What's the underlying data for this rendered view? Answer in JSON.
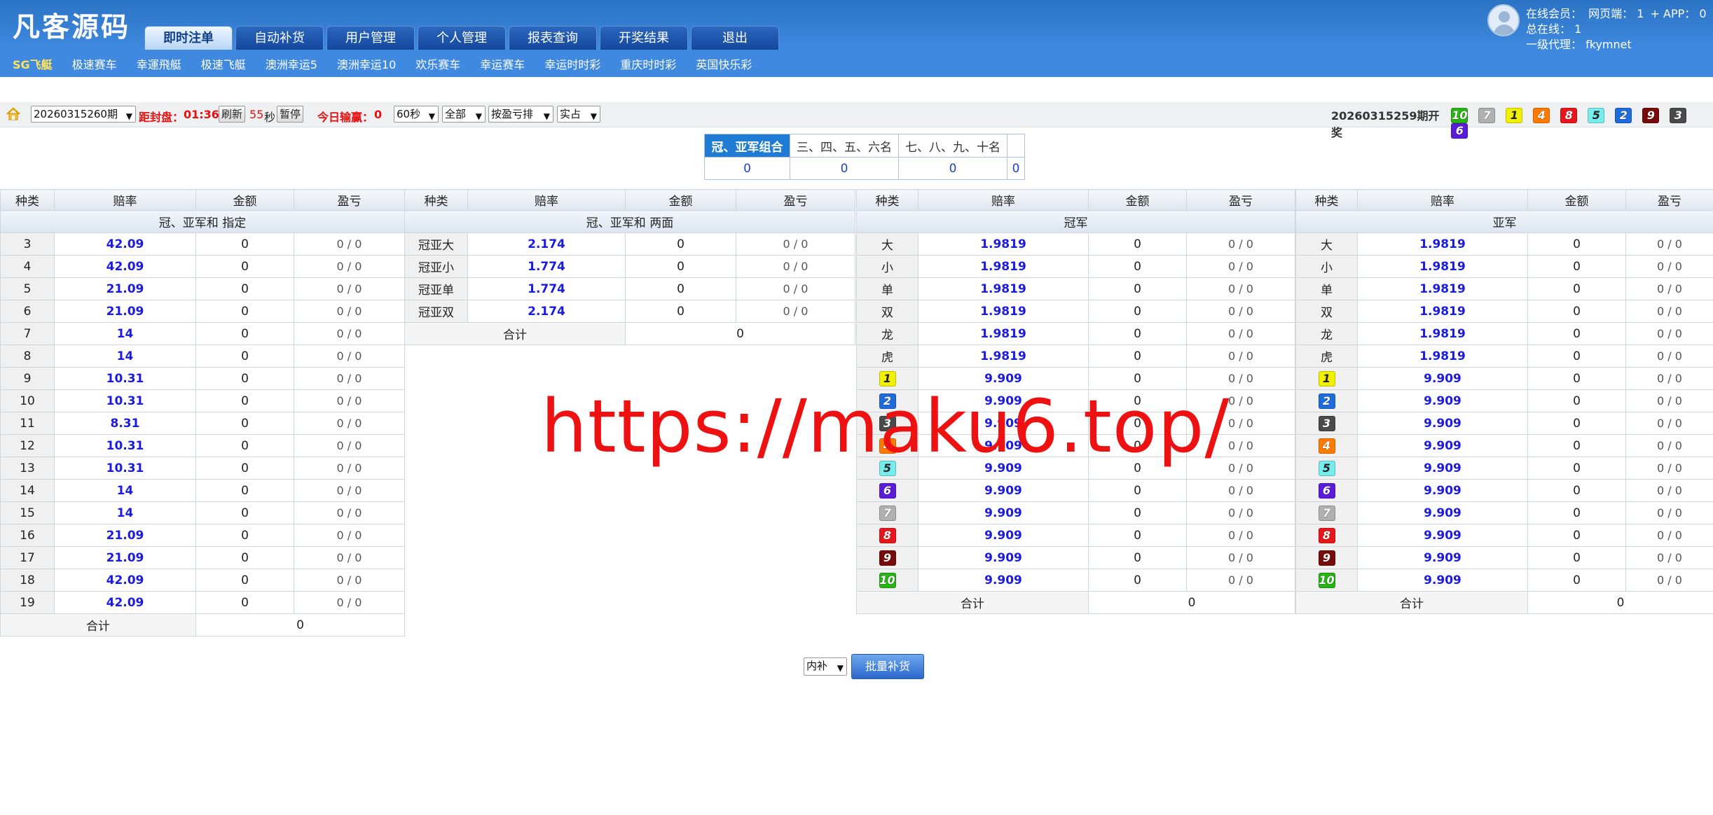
{
  "app": {
    "logo": "凡客源码"
  },
  "nav": [
    "即时注单",
    "自动补货",
    "用户管理",
    "个人管理",
    "报表查询",
    "开奖结果",
    "退出"
  ],
  "user": {
    "online_label": "在线会员：",
    "web_label": "网页端：",
    "web_value": "1",
    "app_label": "+ APP：",
    "app_value": "0",
    "total_label": "总在线：",
    "total_value": "1",
    "agent_label": "一级代理：",
    "agent_value": "fkymnet"
  },
  "subnav": [
    "SG飞艇",
    "极速赛车",
    "幸運飛艇",
    "极速飞艇",
    "澳洲幸运5",
    "澳洲幸运10",
    "欢乐赛车",
    "幸运赛车",
    "幸运时时彩",
    "重庆时时彩",
    "英国快乐彩"
  ],
  "toolbar": {
    "period_select": "20260315260期",
    "close_label": "距封盘：",
    "close_time": "01:36",
    "refresh_btn": "刷新",
    "countdown": "55",
    "seconds_unit": "秒",
    "pause_btn": "暂停",
    "today_label": "今日输赢：",
    "today_value": "0",
    "interval_select": "60秒",
    "scope_select": "全部",
    "sort_select": "按盈亏排",
    "mode_select": "实占",
    "last_period": "20260315259期开奖",
    "last_balls": [
      10,
      7,
      1,
      4,
      8,
      5,
      2,
      9,
      3,
      6
    ]
  },
  "position_tabs": {
    "labels": [
      "冠、亚军组合",
      "三、四、五、六名",
      "七、八、九、十名",
      ""
    ],
    "sums": [
      "0",
      "0",
      "0",
      "0"
    ],
    "active": 0
  },
  "headers": {
    "type": "种类",
    "odds": "赔率",
    "amount": "金额",
    "pl": "盈亏",
    "total": "合计"
  },
  "panels": {
    "sum_specific": {
      "title": "冠、亚军和 指定",
      "rows": [
        {
          "k": "3",
          "o": "42.09",
          "a": "0",
          "p": "0 / 0"
        },
        {
          "k": "4",
          "o": "42.09",
          "a": "0",
          "p": "0 / 0"
        },
        {
          "k": "5",
          "o": "21.09",
          "a": "0",
          "p": "0 / 0"
        },
        {
          "k": "6",
          "o": "21.09",
          "a": "0",
          "p": "0 / 0"
        },
        {
          "k": "7",
          "o": "14",
          "a": "0",
          "p": "0 / 0"
        },
        {
          "k": "8",
          "o": "14",
          "a": "0",
          "p": "0 / 0"
        },
        {
          "k": "9",
          "o": "10.31",
          "a": "0",
          "p": "0 / 0"
        },
        {
          "k": "10",
          "o": "10.31",
          "a": "0",
          "p": "0 / 0"
        },
        {
          "k": "11",
          "o": "8.31",
          "a": "0",
          "p": "0 / 0"
        },
        {
          "k": "12",
          "o": "10.31",
          "a": "0",
          "p": "0 / 0"
        },
        {
          "k": "13",
          "o": "10.31",
          "a": "0",
          "p": "0 / 0"
        },
        {
          "k": "14",
          "o": "14",
          "a": "0",
          "p": "0 / 0"
        },
        {
          "k": "15",
          "o": "14",
          "a": "0",
          "p": "0 / 0"
        },
        {
          "k": "16",
          "o": "21.09",
          "a": "0",
          "p": "0 / 0"
        },
        {
          "k": "17",
          "o": "21.09",
          "a": "0",
          "p": "0 / 0"
        },
        {
          "k": "18",
          "o": "42.09",
          "a": "0",
          "p": "0 / 0"
        },
        {
          "k": "19",
          "o": "42.09",
          "a": "0",
          "p": "0 / 0"
        }
      ],
      "total": "0"
    },
    "sum_both": {
      "title": "冠、亚军和 两面",
      "rows": [
        {
          "k": "冠亚大",
          "o": "2.174",
          "a": "0",
          "p": "0 / 0"
        },
        {
          "k": "冠亚小",
          "o": "1.774",
          "a": "0",
          "p": "0 / 0"
        },
        {
          "k": "冠亚单",
          "o": "1.774",
          "a": "0",
          "p": "0 / 0"
        },
        {
          "k": "冠亚双",
          "o": "2.174",
          "a": "0",
          "p": "0 / 0"
        }
      ],
      "total": "0"
    },
    "champion": {
      "title": "冠军",
      "rows": [
        {
          "k": "大",
          "o": "1.9819",
          "a": "0",
          "p": "0 / 0"
        },
        {
          "k": "小",
          "o": "1.9819",
          "a": "0",
          "p": "0 / 0"
        },
        {
          "k": "单",
          "o": "1.9819",
          "a": "0",
          "p": "0 / 0"
        },
        {
          "k": "双",
          "o": "1.9819",
          "a": "0",
          "p": "0 / 0"
        },
        {
          "k": "龙",
          "o": "1.9819",
          "a": "0",
          "p": "0 / 0"
        },
        {
          "k": "虎",
          "o": "1.9819",
          "a": "0",
          "p": "0 / 0"
        },
        {
          "ball": 1,
          "o": "9.909",
          "a": "0",
          "p": "0 / 0"
        },
        {
          "ball": 2,
          "o": "9.909",
          "a": "0",
          "p": "0 / 0"
        },
        {
          "ball": 3,
          "o": "9.909",
          "a": "0",
          "p": "0 / 0"
        },
        {
          "ball": 4,
          "o": "9.909",
          "a": "0",
          "p": "0 / 0"
        },
        {
          "ball": 5,
          "o": "9.909",
          "a": "0",
          "p": "0 / 0"
        },
        {
          "ball": 6,
          "o": "9.909",
          "a": "0",
          "p": "0 / 0"
        },
        {
          "ball": 7,
          "o": "9.909",
          "a": "0",
          "p": "0 / 0"
        },
        {
          "ball": 8,
          "o": "9.909",
          "a": "0",
          "p": "0 / 0"
        },
        {
          "ball": 9,
          "o": "9.909",
          "a": "0",
          "p": "0 / 0"
        },
        {
          "ball": 10,
          "o": "9.909",
          "a": "0",
          "p": "0 / 0"
        }
      ],
      "total": "0"
    },
    "runner_up": {
      "title": "亚军",
      "rows": [
        {
          "k": "大",
          "o": "1.9819",
          "a": "0",
          "p": "0 / 0"
        },
        {
          "k": "小",
          "o": "1.9819",
          "a": "0",
          "p": "0 / 0"
        },
        {
          "k": "单",
          "o": "1.9819",
          "a": "0",
          "p": "0 / 0"
        },
        {
          "k": "双",
          "o": "1.9819",
          "a": "0",
          "p": "0 / 0"
        },
        {
          "k": "龙",
          "o": "1.9819",
          "a": "0",
          "p": "0 / 0"
        },
        {
          "k": "虎",
          "o": "1.9819",
          "a": "0",
          "p": "0 / 0"
        },
        {
          "ball": 1,
          "o": "9.909",
          "a": "0",
          "p": "0 / 0"
        },
        {
          "ball": 2,
          "o": "9.909",
          "a": "0",
          "p": "0 / 0"
        },
        {
          "ball": 3,
          "o": "9.909",
          "a": "0",
          "p": "0 / 0"
        },
        {
          "ball": 4,
          "o": "9.909",
          "a": "0",
          "p": "0 / 0"
        },
        {
          "ball": 5,
          "o": "9.909",
          "a": "0",
          "p": "0 / 0"
        },
        {
          "ball": 6,
          "o": "9.909",
          "a": "0",
          "p": "0 / 0"
        },
        {
          "ball": 7,
          "o": "9.909",
          "a": "0",
          "p": "0 / 0"
        },
        {
          "ball": 8,
          "o": "9.909",
          "a": "0",
          "p": "0 / 0"
        },
        {
          "ball": 9,
          "o": "9.909",
          "a": "0",
          "p": "0 / 0"
        },
        {
          "ball": 10,
          "o": "9.909",
          "a": "0",
          "p": "0 / 0"
        }
      ],
      "total": "0"
    }
  },
  "bottom": {
    "mode_select": "内补",
    "batch_button": "批量补货"
  },
  "watermark": "https://maku6.top/"
}
